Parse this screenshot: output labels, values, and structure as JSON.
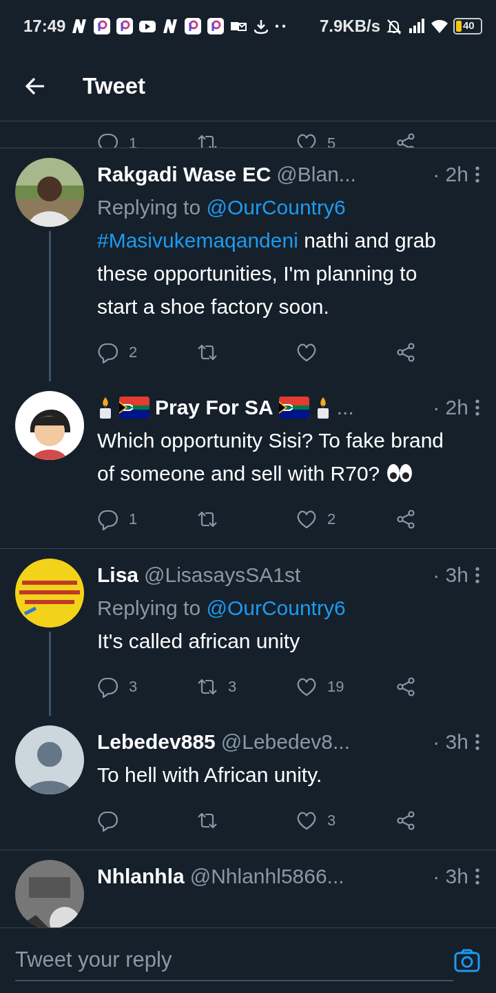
{
  "status_bar": {
    "time": "17:49",
    "speed": "7.9KB/s",
    "battery": "40"
  },
  "header": {
    "title": "Tweet"
  },
  "cut_actions": {
    "reply_count": "1",
    "like_count": "5"
  },
  "tweets": [
    {
      "name": "Rakgadi Wase EC",
      "handle": "@Blan...",
      "time": "· 2h",
      "replying_prefix": "Replying to ",
      "replying_to": "@OurCountry6",
      "hashtag": "#Masivukemaqandeni",
      "text": " nathi and grab these opportunities, I'm planning to start a shoe factory soon.",
      "thread_line": true,
      "reply_count": "2"
    },
    {
      "emoji_name": true,
      "name": "Pray For SA",
      "handle": "...",
      "time": "· 2h",
      "text": "Which opportunity Sisi? To fake brand of someone and sell with R70?",
      "eyes_emoji": true,
      "reply_count": "1",
      "like_count": "2"
    },
    {
      "name": "Lisa",
      "handle": "@LisasaysSA1st",
      "time": "· 3h",
      "replying_prefix": "Replying to ",
      "replying_to": "@OurCountry6",
      "text": "It's called african unity",
      "thread_line": true,
      "reply_count": "3",
      "retweet_count": "3",
      "like_count": "19"
    },
    {
      "avatar": {
        "kind": "default"
      },
      "name": "Lebedev885",
      "handle": "@Lebedev8...",
      "time": "· 3h",
      "text": "To hell with African unity.",
      "like_count": "3"
    },
    {
      "name": "Nhlanhla",
      "handle": "@Nhlanhl5866...",
      "time": "· 3h"
    }
  ],
  "reply_bar": {
    "placeholder": "Tweet your reply"
  }
}
